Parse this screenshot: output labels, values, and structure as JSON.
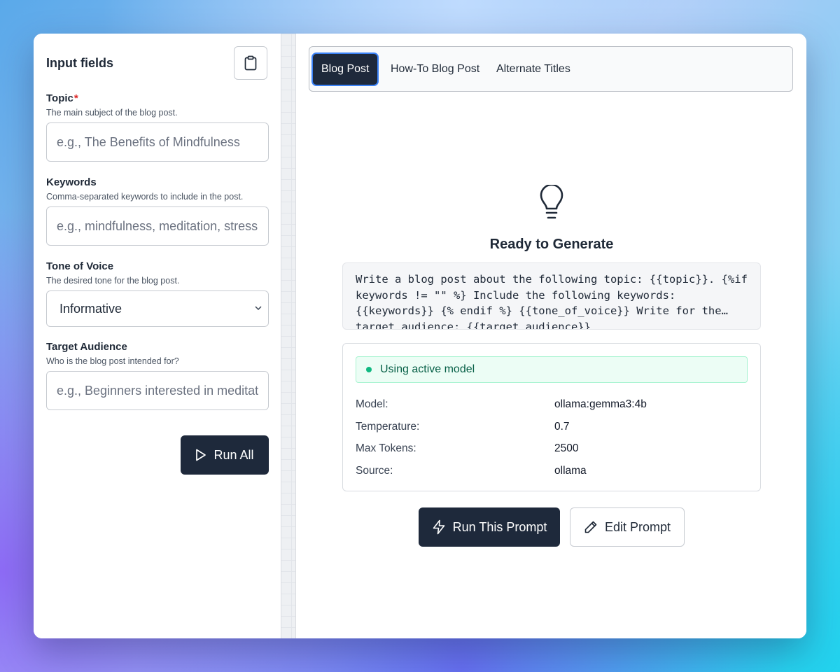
{
  "input_panel": {
    "title": "Input fields",
    "fields": [
      {
        "label": "Topic",
        "required_mark": "*",
        "help": "The main subject of the blog post.",
        "placeholder": "e.g., The Benefits of Mindfulness",
        "value": ""
      },
      {
        "label": "Keywords",
        "help": "Comma-separated keywords to include in the post.",
        "placeholder": "e.g., mindfulness, meditation, stress reduction",
        "value": ""
      },
      {
        "label": "Tone of Voice",
        "help": "The desired tone for the blog post.",
        "selected": "Informative"
      },
      {
        "label": "Target Audience",
        "help": "Who is the blog post intended for?",
        "placeholder": "e.g., Beginners interested in meditation",
        "value": ""
      }
    ],
    "run_all_label": "Run All"
  },
  "tabs": [
    {
      "label": "Blog Post",
      "active": true
    },
    {
      "label": "How-To Blog Post",
      "active": false
    },
    {
      "label": "Alternate Titles",
      "active": false
    }
  ],
  "main": {
    "icon": "lightbulb-icon",
    "title": "Ready to Generate",
    "prompt_preview": "Write a blog post about the following topic: {{topic}}. {%if keywords != \"\" %} Include the following keywords: {{keywords}} {% endif %} {{tone_of_voice}} Write for the target audience: {{target_audience}}",
    "model_status": "Using active model",
    "model_info": [
      {
        "key": "Model:",
        "value": "ollama:gemma3:4b"
      },
      {
        "key": "Temperature:",
        "value": "0.7"
      },
      {
        "key": "Max Tokens:",
        "value": "2500"
      },
      {
        "key": "Source:",
        "value": "ollama"
      }
    ],
    "run_prompt_label": "Run This Prompt",
    "edit_prompt_label": "Edit Prompt"
  },
  "colors": {
    "primary_button": "#1e293b",
    "active_tab_ring": "#3b82f6",
    "status_green": "#10b981",
    "required_red": "#dc2626"
  }
}
